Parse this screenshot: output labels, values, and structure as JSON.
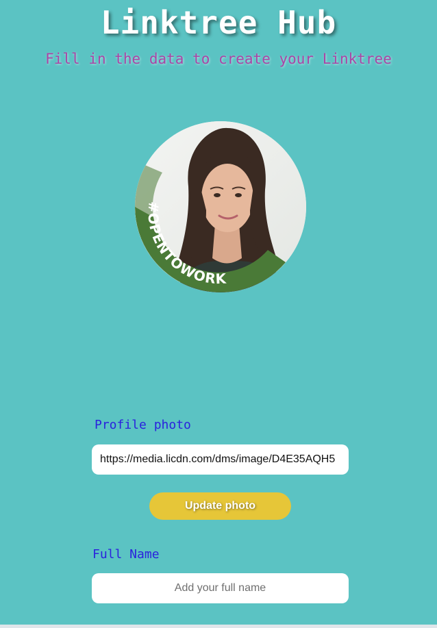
{
  "header": {
    "title": "Linktree Hub",
    "subtitle": "Fill in the data to create your Linktree"
  },
  "profile": {
    "badge_text": "#OPENTOWORK",
    "badge_color": "#4a7a37"
  },
  "form": {
    "photo_label": "Profile photo",
    "photo_value": "https://media.licdn.com/dms/image/D4E35AQH5",
    "update_button_label": "Update photo",
    "name_label": "Full Name",
    "name_placeholder": "Add your full name",
    "name_value": ""
  },
  "colors": {
    "background": "#5bc3c3",
    "title": "#ffffff",
    "subtitle": "#a946a6",
    "label": "#2b22dd",
    "button": "#e6c638"
  }
}
